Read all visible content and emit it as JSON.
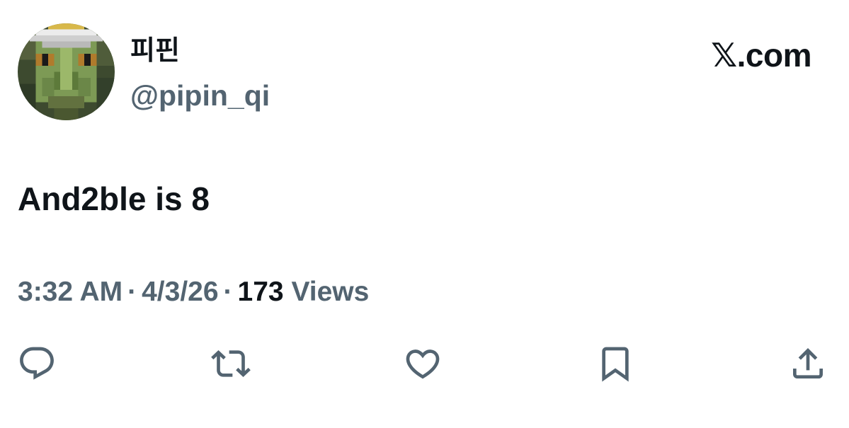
{
  "author": {
    "display_name": "피핀",
    "handle": "@pipin_qi"
  },
  "brand": {
    "label": "𝕏.com"
  },
  "tweet": {
    "text": "And2ble is 8"
  },
  "meta": {
    "time": "3:32 AM",
    "separator": "·",
    "date": "4/3/26",
    "views_count": "173",
    "views_label": "Views"
  },
  "actions": [
    {
      "icon": "reply-icon"
    },
    {
      "icon": "repost-icon"
    },
    {
      "icon": "like-icon"
    },
    {
      "icon": "bookmark-icon"
    },
    {
      "icon": "share-icon"
    }
  ],
  "colors": {
    "text_primary": "#0f1419",
    "text_secondary": "#536471",
    "background": "#ffffff"
  }
}
